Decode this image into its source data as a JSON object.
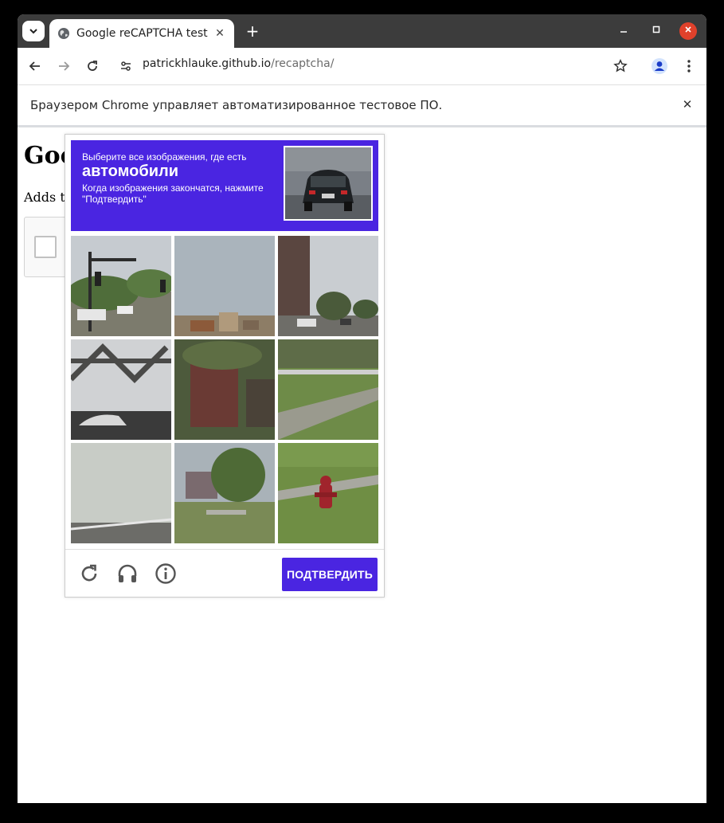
{
  "browser": {
    "tab_title": "Google reCAPTCHA test",
    "url_host": "patrickhlauke.github.io",
    "url_path": "/recaptcha/",
    "infobar_message": "Браузером Chrome управляет автоматизированное тестовое ПО."
  },
  "page": {
    "heading": "Goo",
    "description": "Adds th"
  },
  "challenge": {
    "instruction": "Выберите все изображения, где есть",
    "target": "автомобили",
    "hint": "Когда изображения закончатся, нажмите \"Подтвердить\"",
    "verify_label": "ПОДТВЕРДИТЬ",
    "tiles": [
      "tile-1",
      "tile-2",
      "tile-3",
      "tile-4",
      "tile-5",
      "tile-6",
      "tile-7",
      "tile-8",
      "tile-9"
    ]
  },
  "colors": {
    "accent": "#4a25e1",
    "tabstrip": "#3c3c3c",
    "close": "#e0412b"
  }
}
